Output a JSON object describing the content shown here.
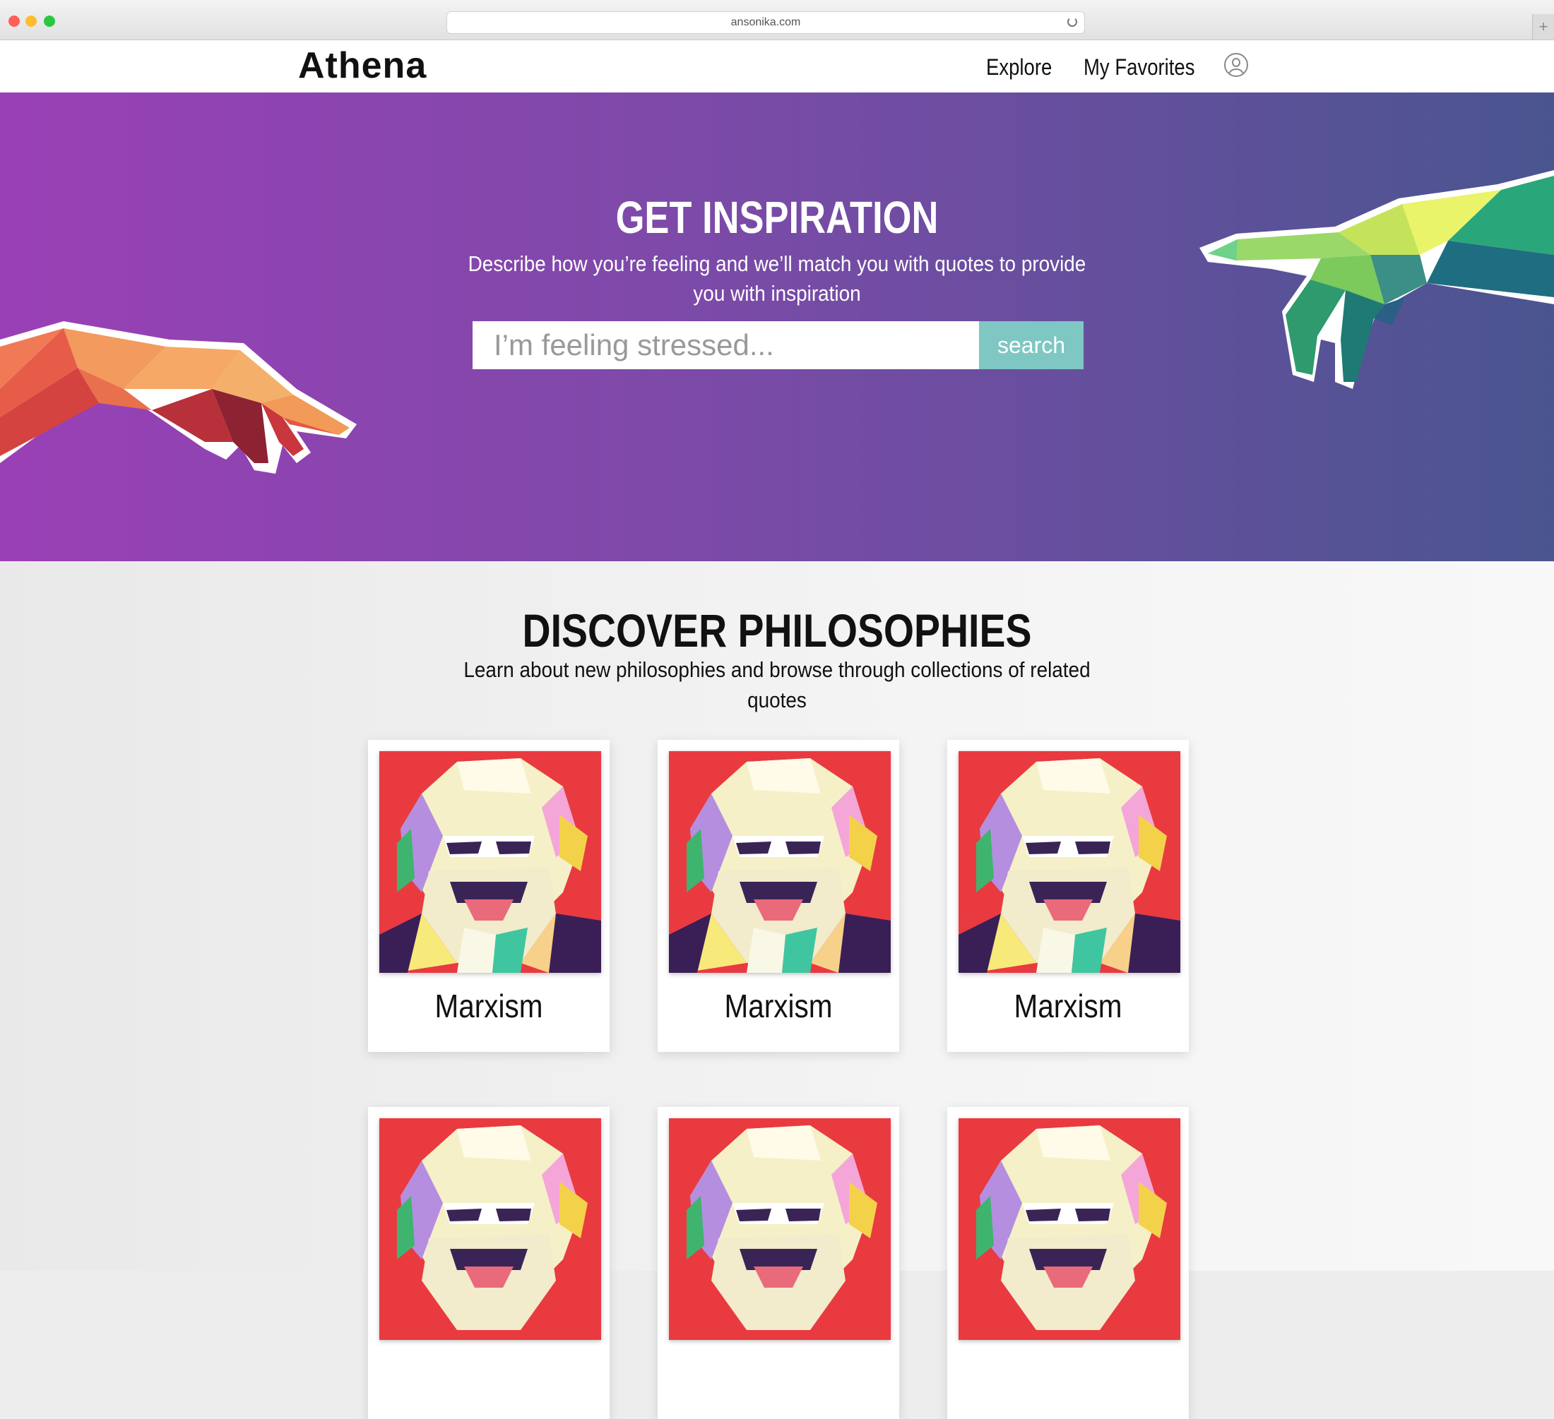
{
  "browser": {
    "url": "ansonika.com"
  },
  "nav": {
    "logo": "Athena",
    "links": [
      "Explore",
      "My Favorites"
    ]
  },
  "hero": {
    "title": "GET INSPIRATION",
    "subtitle": "Describe how you’re feeling and we’ll match you with quotes to provide you with inspiration",
    "search_placeholder": "I’m feeling stressed...",
    "search_button": "search",
    "colors": {
      "gradient_start": "#9a40b6",
      "gradient_end": "#4a5590",
      "button": "#7fc7c2"
    }
  },
  "discover": {
    "title": "DISCOVER PHILOSOPHIES",
    "subtitle": "Learn about new philosophies and browse through collections of related quotes",
    "cards": [
      {
        "label": "Marxism",
        "image": "marx-portrait"
      },
      {
        "label": "Marxism",
        "image": "marx-portrait"
      },
      {
        "label": "Marxism",
        "image": "marx-portrait"
      },
      {
        "label": "",
        "image": "marx-portrait"
      },
      {
        "label": "",
        "image": "marx-portrait"
      },
      {
        "label": "",
        "image": "marx-portrait"
      }
    ]
  }
}
